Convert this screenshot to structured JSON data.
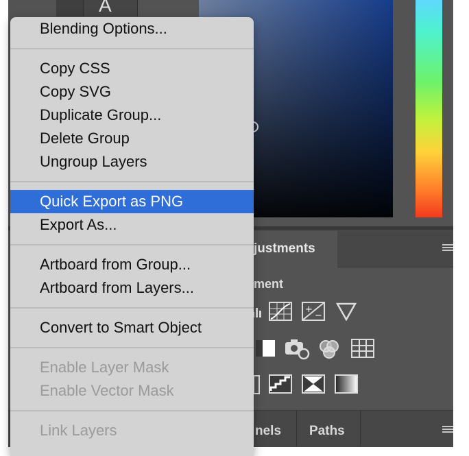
{
  "tool_letter": "A",
  "context_menu": {
    "groups": [
      [
        {
          "label": "Blending Options...",
          "state": "normal"
        }
      ],
      [
        {
          "label": "Copy CSS",
          "state": "normal"
        },
        {
          "label": "Copy SVG",
          "state": "normal"
        },
        {
          "label": "Duplicate Group...",
          "state": "normal"
        },
        {
          "label": "Delete Group",
          "state": "normal"
        },
        {
          "label": "Ungroup Layers",
          "state": "normal"
        }
      ],
      [
        {
          "label": "Quick Export as PNG",
          "state": "highlighted"
        },
        {
          "label": "Export As...",
          "state": "normal"
        }
      ],
      [
        {
          "label": "Artboard from Group...",
          "state": "normal"
        },
        {
          "label": "Artboard from Layers...",
          "state": "normal"
        }
      ],
      [
        {
          "label": "Convert to Smart Object",
          "state": "normal"
        }
      ],
      [
        {
          "label": "Enable Layer Mask",
          "state": "disabled"
        },
        {
          "label": "Enable Vector Mask",
          "state": "disabled"
        }
      ],
      [
        {
          "label": "Link Layers",
          "state": "disabled"
        }
      ]
    ]
  },
  "panels": {
    "adjustments_tab": "justments",
    "adjustments_section": "ment",
    "bottom_tabs": [
      "nels",
      "Paths"
    ]
  },
  "colors": {
    "menu_bg": "#d3d3d3",
    "highlight": "#2f6ed8",
    "panel_bg": "#535353"
  },
  "icons": {
    "adjustments": [
      "levels-icon",
      "curves-icon",
      "exposure-icon",
      "triangle-icon",
      "black-white-icon",
      "photo-filter-icon",
      "channel-mixer-icon",
      "color-lookup-icon",
      "invert-icon",
      "posterize-icon",
      "threshold-icon",
      "gradient-map-icon"
    ]
  }
}
